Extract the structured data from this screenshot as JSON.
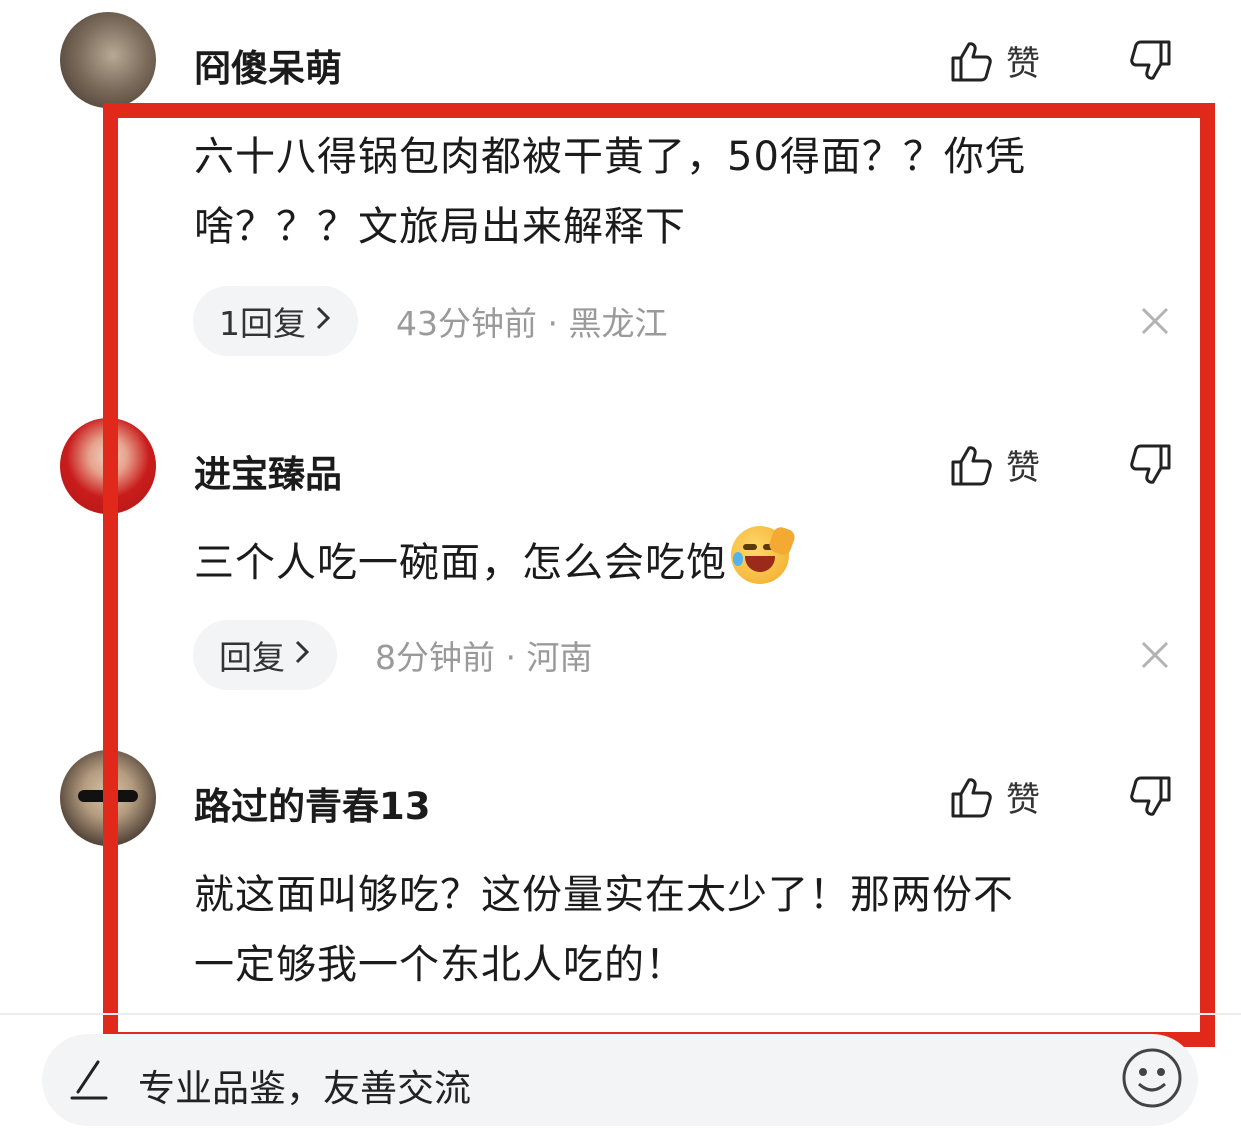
{
  "comments": [
    {
      "username": "冏傻呆萌",
      "like_label": "赞",
      "text_lines": [
        "六十八得锅包肉都被干黄了，50得面？？你凭",
        "啥？？？文旅局出来解释下"
      ],
      "reply_label": "1回复",
      "time_location": "43分钟前 · 黑龙江"
    },
    {
      "username": "进宝臻品",
      "like_label": "赞",
      "text": "三个人吃一碗面，怎么会吃饱",
      "emoji": "laughing-crying-emoji",
      "reply_label": "回复",
      "time_location": "8分钟前 · 河南"
    },
    {
      "username": "路过的青春13",
      "like_label": "赞",
      "text_lines": [
        "就这面叫够吃？这份量实在太少了！那两份不",
        "一定够我一个东北人吃的！"
      ]
    }
  ],
  "input": {
    "placeholder": "专业品鉴，友善交流"
  },
  "icons": {
    "like": "thumbs-up-icon",
    "dislike": "thumbs-down-icon",
    "close": "close-icon",
    "pen": "pen-icon",
    "emoji": "smiley-icon",
    "chevron": "chevron-right-icon"
  },
  "colors": {
    "highlight": "#e0281b",
    "pill_background": "#f3f4f5",
    "meta_text": "#9a9a9a"
  }
}
